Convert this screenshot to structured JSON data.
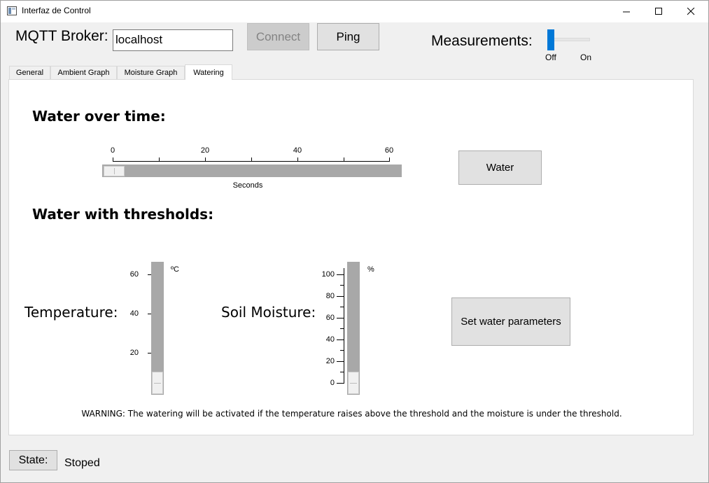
{
  "window": {
    "title": "Interfaz de Control"
  },
  "header": {
    "broker_label": "MQTT Broker:",
    "broker_value": "localhost",
    "connect_label": "Connect",
    "ping_label": "Ping",
    "measurements_label": "Measurements:",
    "toggle_off_label": "Off",
    "toggle_on_label": "On",
    "measurements_on": false
  },
  "tabs": [
    {
      "label": "General",
      "active": false
    },
    {
      "label": "Ambient Graph",
      "active": false
    },
    {
      "label": "Moisture Graph",
      "active": false
    },
    {
      "label": "Watering",
      "active": true
    }
  ],
  "watering": {
    "over_time_title": "Water over time:",
    "time_slider": {
      "ticks": [
        "0",
        "20",
        "40",
        "60"
      ],
      "unit": "Seconds",
      "value": 0,
      "min": 0,
      "max": 60
    },
    "water_button_label": "Water",
    "thresholds_title": "Water with thresholds:",
    "temperature_label": "Temperature:",
    "temperature_slider": {
      "ticks": [
        "60",
        "40",
        "20"
      ],
      "unit": "ºC",
      "value": 0
    },
    "moisture_label": "Soil Moisture:",
    "moisture_slider": {
      "ticks": [
        "100",
        "80",
        "60",
        "40",
        "20",
        "0"
      ],
      "unit": "%",
      "value": 0
    },
    "set_params_label": "Set water parameters",
    "warning_text": "WARNING: The watering will be activated if the temperature raises above the threshold and the moisture is under the threshold."
  },
  "status": {
    "state_label": "State:",
    "state_value": "Stoped"
  },
  "colors": {
    "accent": "#0078d7",
    "groove": "#a8a8a8",
    "panel": "#ffffff",
    "background": "#f0f0f0"
  }
}
